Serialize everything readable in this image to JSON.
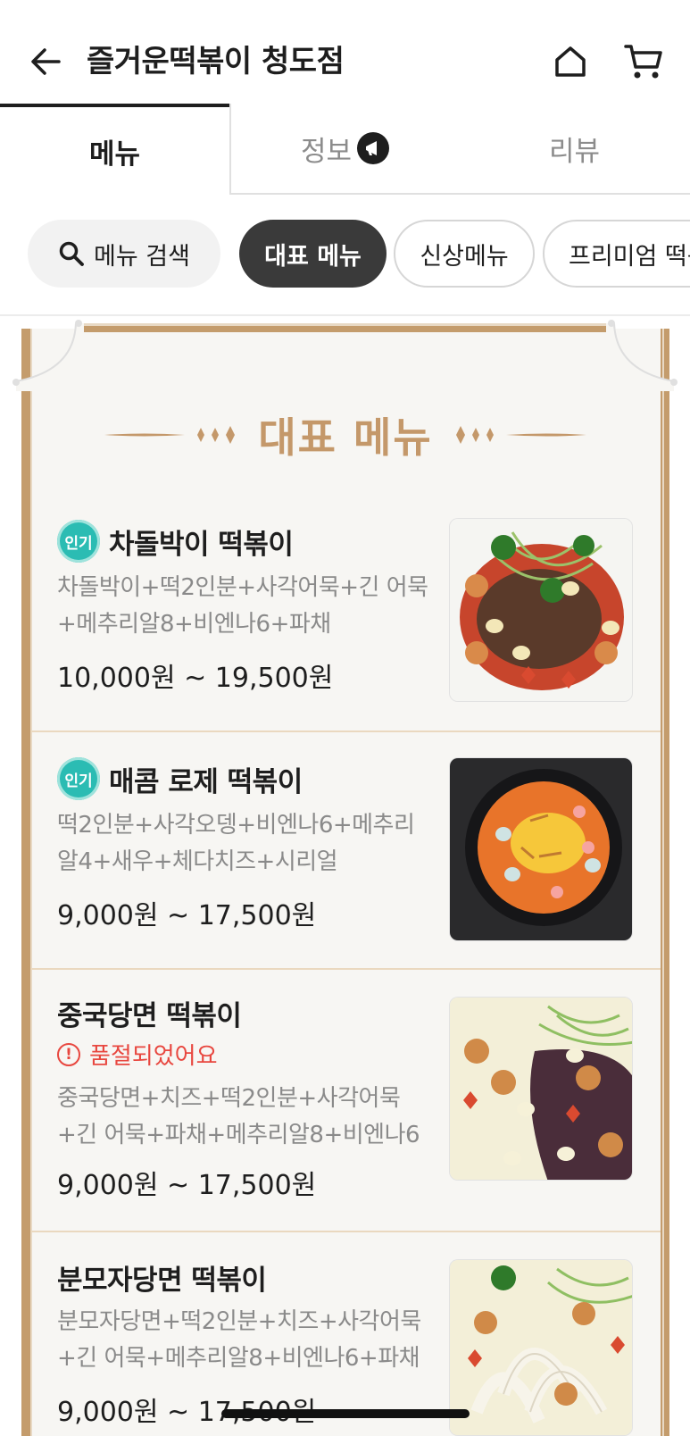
{
  "header": {
    "title": "즐거운떡볶이 청도점",
    "back_icon": "arrow-left-icon",
    "home_icon": "home-icon",
    "cart_icon": "cart-icon"
  },
  "tabs": [
    {
      "label": "메뉴",
      "active": true
    },
    {
      "label": "정보",
      "active": false,
      "icon": "megaphone-icon"
    },
    {
      "label": "리뷰",
      "active": false
    }
  ],
  "chips": {
    "search_label": "메뉴 검색",
    "items": [
      "대표 메뉴",
      "신상메뉴",
      "프리미엄 떡볶"
    ]
  },
  "section": {
    "heading": "대표 메뉴"
  },
  "menu_items": [
    {
      "badge": "인기",
      "name": "차돌박이 떡볶이",
      "description": "차돌박이+떡2인분+사각어묵+긴 어묵+메추리알8+비엔나6+파채",
      "price": "10,000원 ~ 19,500원"
    },
    {
      "badge": "인기",
      "name": "매콤 로제 떡볶이",
      "description": "떡2인분+사각오뎅+비엔나6+메추리알4+새우+체다치즈+시리얼",
      "price": "9,000원 ~ 17,500원"
    },
    {
      "name": "중국당면 떡볶이",
      "status": "품절되었어요",
      "description": "중국당면+치즈+떡2인분+사각어묵+긴 어묵+파채+메추리알8+비엔나6",
      "price": "9,000원 ~ 17,500원"
    },
    {
      "name": "분모자당면 떡볶이",
      "description": "분모자당면+떡2인분+치즈+사각어묵+긴 어묵+메추리알8+비엔나6+파채",
      "price": "9,000원 ~ 17,500원"
    }
  ],
  "colors": {
    "accent_gold": "#c49c6c",
    "badge_teal": "#2bbcb3",
    "soldout_red": "#e8473f",
    "active_chip": "#3a3a3a"
  }
}
